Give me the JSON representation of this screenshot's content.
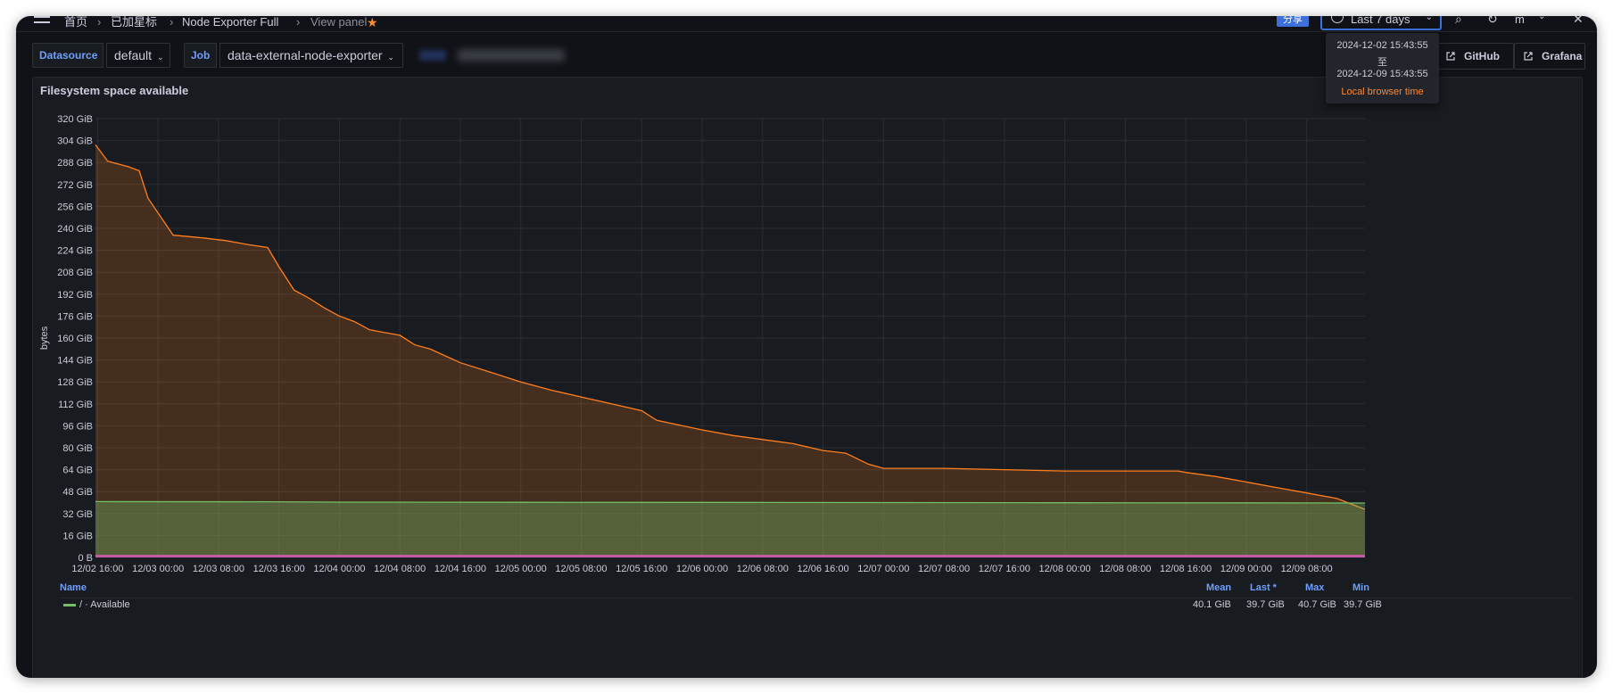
{
  "topbar": {
    "breadcrumbs": [
      "首页",
      "已加星标",
      "Node Exporter Full",
      "View panel"
    ],
    "share_label": "分享",
    "time_range_label": "Last 7 days",
    "user_initial": "m"
  },
  "variables": {
    "datasource_label": "Datasource",
    "datasource_value": "default",
    "job_label": "Job",
    "job_value": "data-external-node-exporter"
  },
  "links": {
    "github_label": "GitHub",
    "grafana_label": "Grafana"
  },
  "time_tooltip": {
    "from": "2024-12-02 15:43:55",
    "to_word": "至",
    "to": "2024-12-09 15:43:55",
    "zone": "Local browser time"
  },
  "panel": {
    "title": "Filesystem space available"
  },
  "legend": {
    "headers": {
      "name": "Name",
      "mean": "Mean",
      "last": "Last *",
      "max": "Max",
      "min": "Min"
    },
    "row": {
      "name": "/ · Available",
      "mean": "40.1 GiB",
      "last": "39.7 GiB",
      "max": "40.7 GiB",
      "min": "39.7 GiB"
    }
  },
  "colors": {
    "accent": "#3d71d9",
    "series_orange": "#ff7f1e",
    "series_green": "#73bf69",
    "series_pink": "#c35ca2",
    "background": "#111217",
    "panel": "#181b1f"
  },
  "chart_data": {
    "type": "area",
    "xlabel": "",
    "ylabel": "bytes",
    "ylim": [
      0,
      320
    ],
    "y_unit": "GiB",
    "y_ticks": [
      "0 B",
      "16 GiB",
      "32 GiB",
      "48 GiB",
      "64 GiB",
      "80 GiB",
      "96 GiB",
      "112 GiB",
      "128 GiB",
      "144 GiB",
      "160 GiB",
      "176 GiB",
      "192 GiB",
      "208 GiB",
      "224 GiB",
      "240 GiB",
      "256 GiB",
      "272 GiB",
      "288 GiB",
      "304 GiB",
      "320 GiB"
    ],
    "x_ticks": [
      "12/02 16:00",
      "12/03 00:00",
      "12/03 08:00",
      "12/03 16:00",
      "12/04 00:00",
      "12/04 08:00",
      "12/04 16:00",
      "12/05 00:00",
      "12/05 08:00",
      "12/05 16:00",
      "12/06 00:00",
      "12/06 08:00",
      "12/06 16:00",
      "12/07 00:00",
      "12/07 08:00",
      "12/07 16:00",
      "12/08 00:00",
      "12/08 08:00",
      "12/08 16:00",
      "12/09 00:00",
      "12/09 08:00"
    ],
    "x_start": "2024-12-02 15:43",
    "x_end": "2024-12-09 15:43",
    "legend_position": "bottom",
    "grid": true,
    "series": [
      {
        "color": "#ff7f1e",
        "x": [
          "2024-12-02 15:43",
          "2024-12-02 17:20",
          "2024-12-02 20:00",
          "2024-12-02 21:30",
          "2024-12-02 22:40",
          "2024-12-03 02:00",
          "2024-12-03 04:00",
          "2024-12-03 06:00",
          "2024-12-03 09:00",
          "2024-12-03 12:00",
          "2024-12-03 14:30",
          "2024-12-03 16:00",
          "2024-12-03 18:00",
          "2024-12-03 20:00",
          "2024-12-03 22:00",
          "2024-12-04 00:00",
          "2024-12-04 02:00",
          "2024-12-04 04:00",
          "2024-12-04 06:00",
          "2024-12-04 08:00",
          "2024-12-04 10:00",
          "2024-12-04 12:00",
          "2024-12-04 16:00",
          "2024-12-04 20:00",
          "2024-12-05 00:00",
          "2024-12-05 04:00",
          "2024-12-05 08:00",
          "2024-12-05 12:00",
          "2024-12-05 16:00",
          "2024-12-05 18:00",
          "2024-12-06 00:00",
          "2024-12-06 04:00",
          "2024-12-06 08:00",
          "2024-12-06 12:00",
          "2024-12-06 16:00",
          "2024-12-06 19:00",
          "2024-12-06 22:00",
          "2024-12-07 00:00",
          "2024-12-07 08:00",
          "2024-12-07 16:00",
          "2024-12-08 00:00",
          "2024-12-08 08:00",
          "2024-12-08 15:00",
          "2024-12-08 16:00",
          "2024-12-08 20:00",
          "2024-12-09 00:00",
          "2024-12-09 04:00",
          "2024-12-09 08:00",
          "2024-12-09 12:00",
          "2024-12-09 15:43"
        ],
        "values": [
          301,
          289,
          285,
          282,
          262,
          235,
          234,
          233,
          231,
          228,
          226,
          212,
          195,
          189,
          182,
          176,
          172,
          166,
          164,
          162,
          155,
          152,
          142,
          135,
          128,
          122,
          117,
          112,
          107,
          100,
          93,
          89,
          86,
          83,
          78,
          76,
          68,
          65,
          65,
          64,
          63,
          63,
          63,
          62,
          59,
          55,
          51,
          47,
          43,
          35
        ]
      },
      {
        "color": "#73bf69",
        "x": [
          "2024-12-02 15:43",
          "2024-12-03 16:00",
          "2024-12-04 00:00",
          "2024-12-05 00:00",
          "2024-12-06 00:00",
          "2024-12-07 00:00",
          "2024-12-08 00:00",
          "2024-12-09 00:00",
          "2024-12-09 15:43"
        ],
        "values": [
          40.7,
          40.6,
          40.3,
          40.2,
          40.1,
          40.0,
          39.9,
          39.8,
          39.7
        ]
      },
      {
        "color": "#c35ca2",
        "x": [
          "2024-12-02 15:43",
          "2024-12-09 15:43"
        ],
        "values": [
          1,
          1
        ]
      }
    ]
  }
}
